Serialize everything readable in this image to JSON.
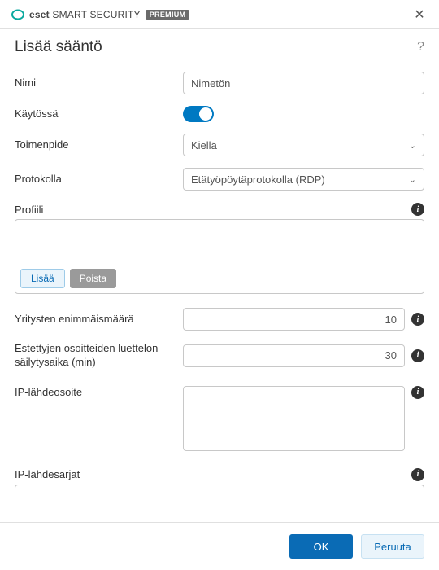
{
  "brand": {
    "eset": "eset",
    "product": "SMART SECURITY",
    "tier": "PREMIUM"
  },
  "title": "Lisää sääntö",
  "fields": {
    "name": {
      "label": "Nimi",
      "value": "Nimetön"
    },
    "enabled": {
      "label": "Käytössä",
      "on": true
    },
    "action": {
      "label": "Toimenpide",
      "selected": "Kiellä"
    },
    "protocol": {
      "label": "Protokolla",
      "selected": "Etätyöpöytäprotokolla (RDP)"
    },
    "profile": {
      "label": "Profiili"
    },
    "max_attempts": {
      "label": "Yritysten enimmäismäärä",
      "value": "10"
    },
    "block_retention": {
      "label": "Estettyjen osoitteiden luettelon säilytysaika (min)",
      "value": "30"
    },
    "ip_source": {
      "label": "IP-lähdeosoite"
    },
    "ip_ranges": {
      "label": "IP-lähdesarjat"
    }
  },
  "buttons": {
    "add": "Lisää",
    "remove": "Poista",
    "ok": "OK",
    "cancel": "Peruuta"
  }
}
